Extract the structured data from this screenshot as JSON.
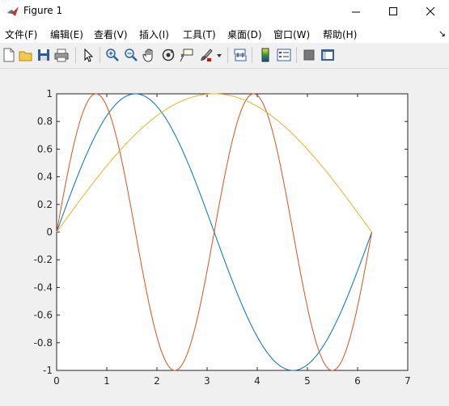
{
  "window": {
    "title": "Figure 1"
  },
  "menu": [
    "文件(F)",
    "编辑(E)",
    "查看(V)",
    "插入(I)",
    "工具(T)",
    "桌面(D)",
    "窗口(W)",
    "帮助(H)"
  ],
  "toolbar_icons": [
    "new-figure-icon",
    "open-file-icon",
    "save-icon",
    "print-icon",
    "pointer-icon",
    "zoom-in-icon",
    "zoom-out-icon",
    "pan-hand-icon",
    "rotate-3d-icon",
    "data-cursor-icon",
    "brush-icon",
    "dropdown-arrow-icon",
    "link-plot-icon",
    "colorbar-icon",
    "legend-icon",
    "hide-plot-tools-icon",
    "show-plot-tools-icon"
  ],
  "chart_data": {
    "type": "line",
    "title": "",
    "xlabel": "",
    "ylabel": "",
    "xlim": [
      0,
      7
    ],
    "ylim": [
      -1,
      1
    ],
    "xticks": [
      "0",
      "1",
      "2",
      "3",
      "4",
      "5",
      "6",
      "7"
    ],
    "yticks": [
      "-1",
      "-0.8",
      "-0.6",
      "-0.4",
      "-0.2",
      "0",
      "0.2",
      "0.4",
      "0.6",
      "0.8",
      "1"
    ],
    "grid": false,
    "x_range": [
      0,
      6.2832
    ],
    "series": [
      {
        "expression": "sin(x)",
        "color": "#0072BD"
      },
      {
        "expression": "sin(2x)",
        "color": "#D95319"
      },
      {
        "expression": "sin(x/2)",
        "color": "#EDB120"
      }
    ]
  }
}
